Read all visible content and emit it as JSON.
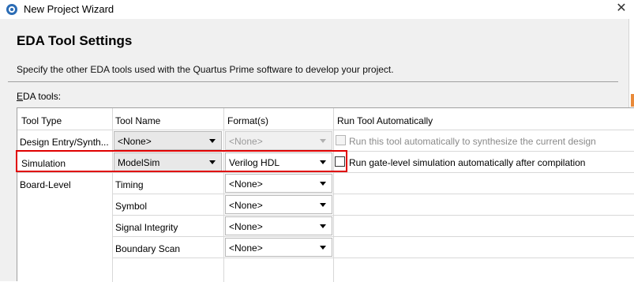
{
  "window": {
    "title": "New Project Wizard",
    "close_glyph": "✕"
  },
  "page": {
    "title": "EDA Tool Settings",
    "description": "Specify the other EDA tools used with the Quartus Prime software to develop your project.",
    "tools_label_prefix": "E",
    "tools_label_rest": "DA tools:"
  },
  "table": {
    "headers": {
      "tool_type": "Tool Type",
      "tool_name": "Tool Name",
      "format": "Format(s)",
      "run_auto": "Run Tool Automatically"
    },
    "rows": [
      {
        "tool_type": "Design Entry/Synth...",
        "tool_name": "<None>",
        "format": "<None>",
        "run_auto": "Run this tool automatically to synthesize the current design"
      },
      {
        "tool_type": "Simulation",
        "tool_name": "ModelSim",
        "format": "Verilog HDL",
        "run_auto": "Run gate-level simulation automatically after compilation"
      },
      {
        "tool_type": "Board-Level",
        "tool_name": "Timing",
        "format": "<None>"
      },
      {
        "tool_type": "",
        "tool_name": "Symbol",
        "format": "<None>"
      },
      {
        "tool_type": "",
        "tool_name": "Signal Integrity",
        "format": "<None>"
      },
      {
        "tool_type": "",
        "tool_name": "Boundary Scan",
        "format": "<None>"
      }
    ]
  },
  "colors": {
    "highlight_box": "#e00000",
    "header_bg": "#f0f0f0",
    "accent_strip": "#e98a3a"
  }
}
